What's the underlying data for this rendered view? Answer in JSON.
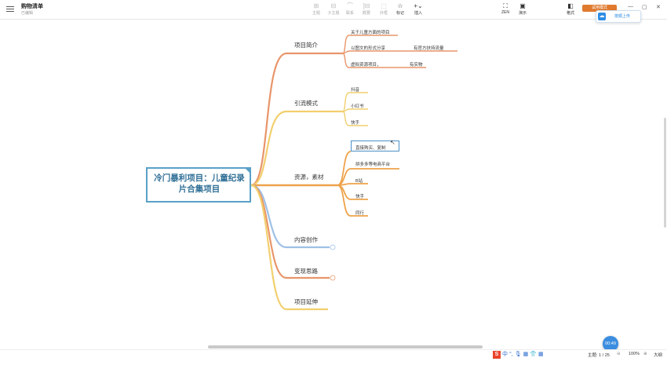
{
  "header": {
    "doc_title": "购物清单",
    "doc_subtitle": "已编辑",
    "tools": [
      {
        "label": "主题",
        "icon": "⊞"
      },
      {
        "label": "子主题",
        "icon": "⊟"
      },
      {
        "label": "联系",
        "icon": "⌒"
      },
      {
        "label": "概要",
        "icon": "]⊟"
      },
      {
        "label": "外框",
        "icon": "⬚"
      },
      {
        "label": "标记",
        "icon": "☆"
      },
      {
        "label": "插入",
        "icon": "+⌄"
      }
    ],
    "right_tools": [
      {
        "label": "ZEN",
        "icon": "⛶"
      },
      {
        "label": "演示",
        "icon": "▣"
      },
      {
        "label": "格式",
        "icon": "◧"
      }
    ],
    "orange_tab_label": "试用模式",
    "upload_label": "按顺上传",
    "window_controls": [
      "—",
      "▢",
      "✕"
    ]
  },
  "mindmap": {
    "root": "冷门暴利项目：儿童纪录片合集项目",
    "branches": [
      {
        "label": "项目简介",
        "color": "#e8956a",
        "leaves": [
          "关于儿童方面的项目",
          "以图文的形式分享",
          "虚拟资源项目，",
          "有官方扶持流量",
          "有实物"
        ]
      },
      {
        "label": "引流模式",
        "color": "#f2cf6e",
        "leaves": [
          "抖音",
          "小红书",
          "快手"
        ]
      },
      {
        "label": "资源，素材",
        "color": "#eea24a",
        "leaves": [
          "直接购买、复制",
          "拼多多等电商平台",
          "B站",
          "快手",
          "同行"
        ]
      },
      {
        "label": "内容创作",
        "color": "#9ec0e6"
      },
      {
        "label": "变现思路",
        "color": "#e8956a"
      },
      {
        "label": "项目延伸",
        "color": "#f2cf6e"
      }
    ]
  },
  "statusbar": {
    "topic_count": "主题: 1 / 25",
    "zoom": "100%",
    "outline_label": "大纲",
    "timer": "00:49",
    "ime_glyphs": [
      "中",
      "°,",
      "🎙",
      "▦",
      "👕",
      "▦"
    ]
  }
}
